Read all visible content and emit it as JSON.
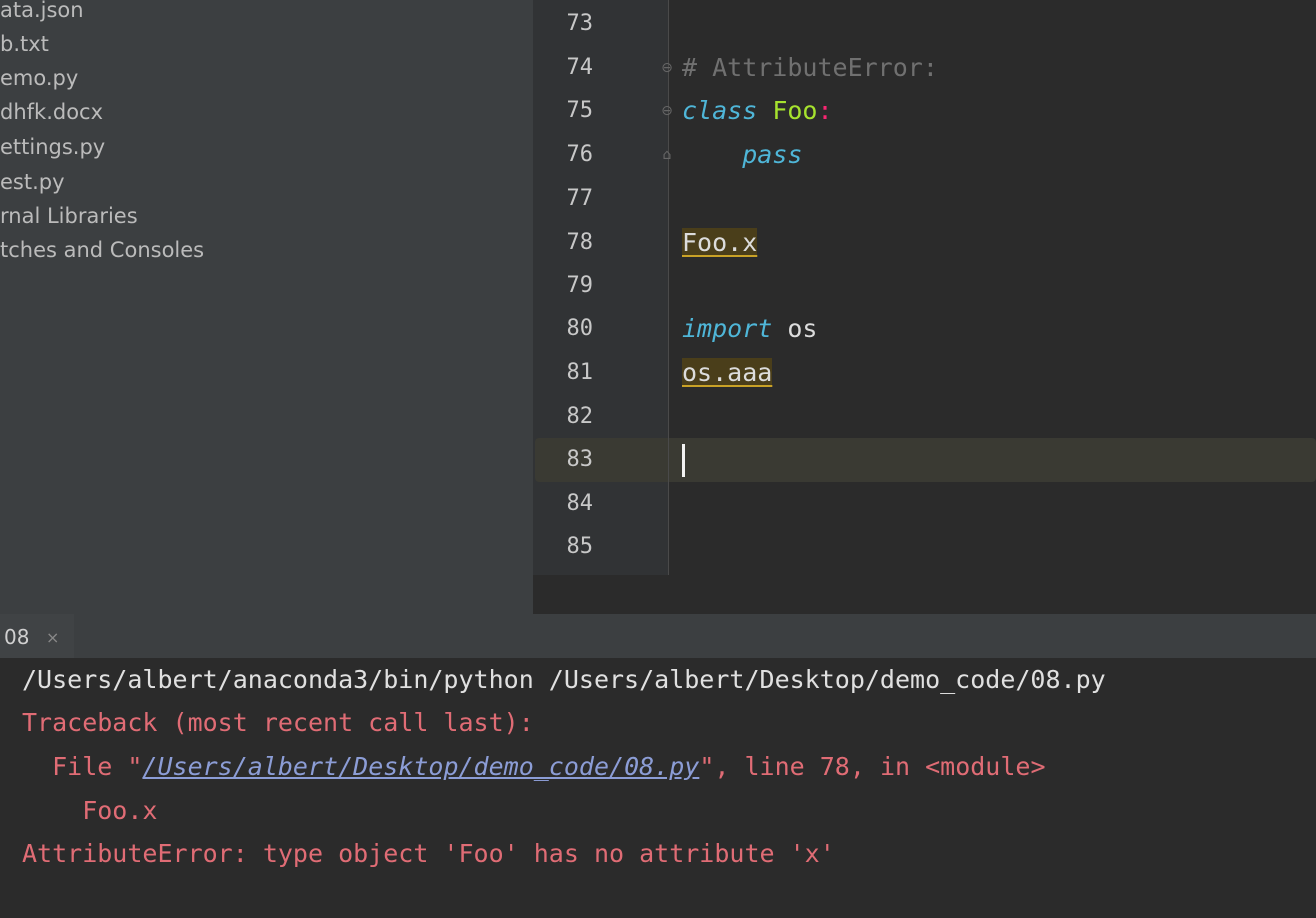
{
  "project_tree": {
    "items": [
      {
        "label": "ata.json"
      },
      {
        "label": "b.txt"
      },
      {
        "label": "emo.py"
      },
      {
        "label": "dhfk.docx"
      },
      {
        "label": "ettings.py"
      },
      {
        "label": "est.py"
      },
      {
        "label": "rnal Libraries"
      },
      {
        "label": "tches and Consoles"
      }
    ]
  },
  "editor": {
    "line_numbers": [
      "73",
      "74",
      "75",
      "76",
      "77",
      "78",
      "79",
      "80",
      "81",
      "82",
      "83",
      "84",
      "85"
    ],
    "current_line": "83",
    "code": {
      "line74_comment": "# AttributeError:",
      "line75_keyword": "class",
      "line75_name": "Foo",
      "line75_colon": ":",
      "line76_keyword": "pass",
      "line78_expr": "Foo.x",
      "line80_keyword": "import",
      "line80_module": "os",
      "line81_expr": "os.aaa"
    }
  },
  "run_panel": {
    "tab_label": "08",
    "tab_close_glyph": "×",
    "command": "/Users/albert/anaconda3/bin/python /Users/albert/Desktop/demo_code/08.py",
    "traceback_header": "Traceback (most recent call last):",
    "file_prefix": "  File \"",
    "file_path": "/Users/albert/Desktop/demo_code/08.py",
    "file_suffix": "\", line 78, in <module>",
    "source_line": "    Foo.x",
    "error_message": "AttributeError: type object 'Foo' has no attribute 'x'"
  },
  "colors": {
    "editor_bg": "#2b2b2b",
    "sidebar_bg": "#3c3f41",
    "keyword": "#4fb6d8",
    "class_name": "#a6e22e",
    "error_text": "#e06c75",
    "link": "#8c9dd6"
  },
  "icons": {
    "fold_marker": "fold-marker-icon",
    "tab_close": "close-icon"
  }
}
